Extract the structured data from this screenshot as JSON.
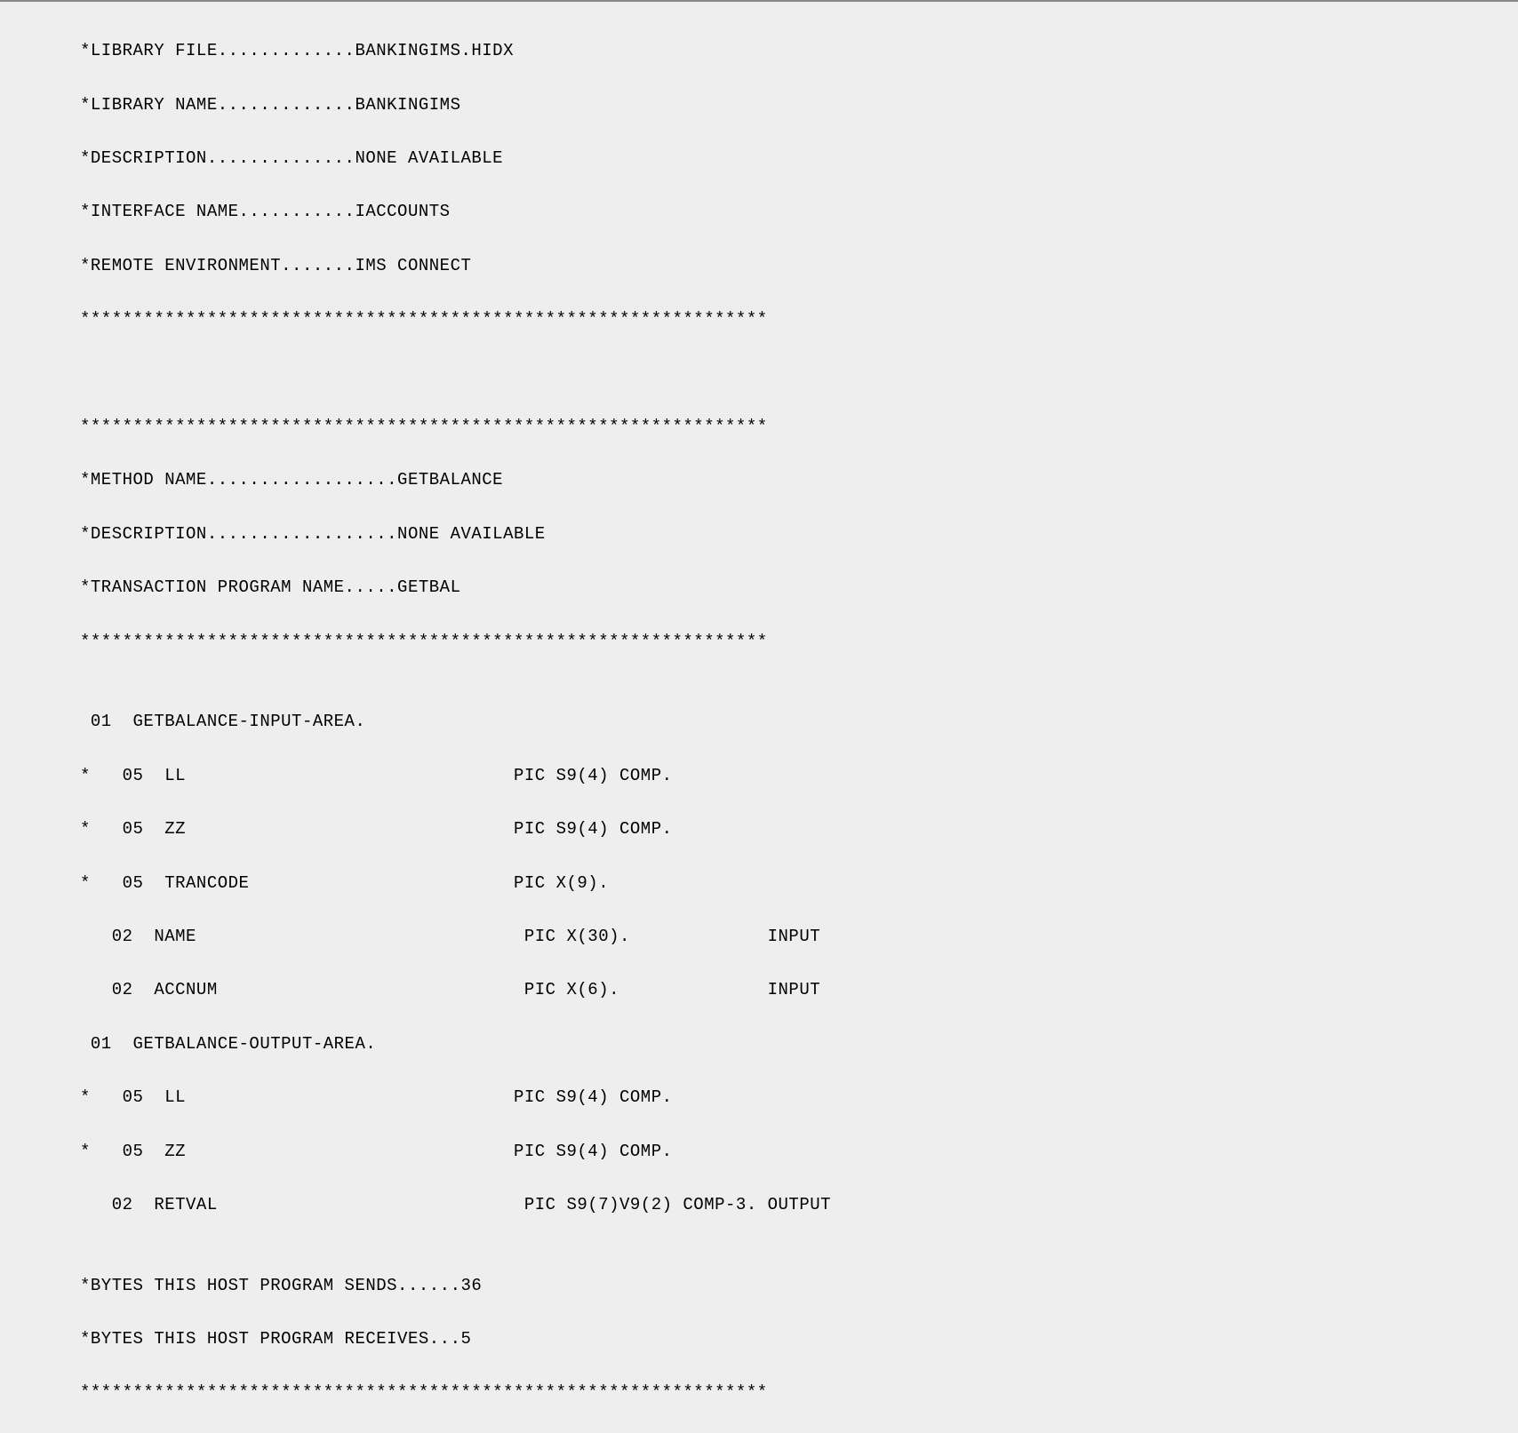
{
  "lines": [
    "*LIBRARY FILE.............BANKINGIMS.HIDX",
    "*LIBRARY NAME.............BANKINGIMS",
    "*DESCRIPTION..............NONE AVAILABLE",
    "*INTERFACE NAME...........IACCOUNTS",
    "*REMOTE ENVIRONMENT.......IMS CONNECT",
    "*****************************************************************",
    "",
    "",
    "*****************************************************************",
    "*METHOD NAME..................GETBALANCE",
    "*DESCRIPTION..................NONE AVAILABLE",
    "*TRANSACTION PROGRAM NAME.....GETBAL",
    "*****************************************************************",
    "",
    " 01  GETBALANCE-INPUT-AREA.",
    "*   05  LL                               PIC S9(4) COMP.",
    "*   05  ZZ                               PIC S9(4) COMP.",
    "*   05  TRANCODE                         PIC X(9).",
    "   02  NAME                               PIC X(30).             INPUT",
    "   02  ACCNUM                             PIC X(6).              INPUT",
    " 01  GETBALANCE-OUTPUT-AREA.",
    "*   05  LL                               PIC S9(4) COMP.",
    "*   05  ZZ                               PIC S9(4) COMP.",
    "   02  RETVAL                             PIC S9(7)V9(2) COMP-3. OUTPUT",
    "",
    "*BYTES THIS HOST PROGRAM SENDS......36",
    "*BYTES THIS HOST PROGRAM RECEIVES...5",
    "*****************************************************************"
  ]
}
